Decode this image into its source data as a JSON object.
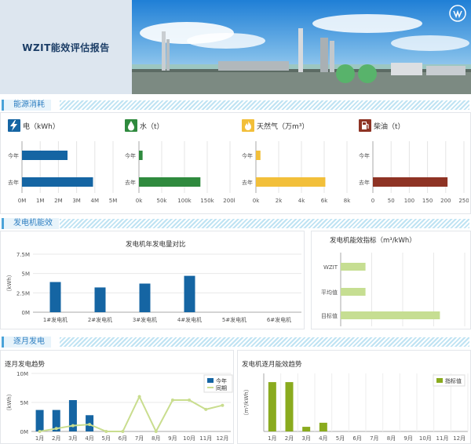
{
  "header": {
    "title": "WZIT能效评估报告"
  },
  "sections": {
    "energy": "能源消耗",
    "generator": "发电机能效",
    "monthly": "逐月发电"
  },
  "colors": {
    "electric": "#1565a3",
    "water": "#2f8a3e",
    "gas": "#f2bf3a",
    "diesel": "#8e3324",
    "efficiency": "#c6de92",
    "monthly_eff": "#8aab1e",
    "prev_line": "#c9dd8e",
    "section_blue": "#2f7fc1"
  },
  "energy_cards": [
    {
      "key": "electric",
      "icon": "lightning-icon",
      "label": "电（kWh）",
      "row_labels": [
        "今年",
        "去年"
      ],
      "chart_data": {
        "type": "bar",
        "orientation": "horizontal",
        "categories": [
          "今年",
          "去年"
        ],
        "values": [
          2500000,
          3900000
        ],
        "xlim": [
          0,
          5000000
        ],
        "ticks": [
          "0M",
          "1M",
          "2M",
          "3M",
          "4M",
          "5M"
        ]
      }
    },
    {
      "key": "water",
      "icon": "water-drop-icon",
      "label": "水（t）",
      "row_labels": [
        "今年",
        "去年"
      ],
      "chart_data": {
        "type": "bar",
        "orientation": "horizontal",
        "categories": [
          "今年",
          "去年"
        ],
        "values": [
          8000,
          135000
        ],
        "xlim": [
          0,
          200000
        ],
        "ticks": [
          "0k",
          "50k",
          "100k",
          "150k",
          "200k"
        ]
      }
    },
    {
      "key": "gas",
      "icon": "flame-icon",
      "label": "天然气（万m³）",
      "row_labels": [
        "今年",
        "去年"
      ],
      "chart_data": {
        "type": "bar",
        "orientation": "horizontal",
        "categories": [
          "今年",
          "去年"
        ],
        "values": [
          400,
          6100
        ],
        "xlim": [
          0,
          8000
        ],
        "ticks": [
          "0k",
          "2k",
          "4k",
          "6k",
          "8k"
        ]
      }
    },
    {
      "key": "diesel",
      "icon": "fuel-pump-icon",
      "label": "柴油（t）",
      "row_labels": [
        "今年",
        "去年"
      ],
      "chart_data": {
        "type": "bar",
        "orientation": "horizontal",
        "categories": [
          "今年",
          "去年"
        ],
        "values": [
          0,
          205
        ],
        "xlim": [
          0,
          250
        ],
        "ticks": [
          "0",
          "50",
          "100",
          "150",
          "200",
          "250"
        ]
      }
    }
  ],
  "generator_output": {
    "title": "发电机年发电量对比",
    "ylabel": "（kWh）",
    "chart_data": {
      "type": "bar",
      "categories": [
        "1#发电机",
        "2#发电机",
        "3#发电机",
        "4#发电机",
        "5#发电机",
        "6#发电机"
      ],
      "values": [
        3900000,
        3200000,
        3700000,
        4700000,
        0,
        0
      ],
      "ylim": [
        0,
        7500000
      ],
      "ticks": [
        "0M",
        "2.5M",
        "5M",
        "7.5M"
      ]
    }
  },
  "generator_eff": {
    "title": "发电机能效指标（m³/kWh）",
    "chart_data": {
      "type": "bar",
      "orientation": "horizontal",
      "categories": [
        "WZIT",
        "平均值",
        "目标值"
      ],
      "values": [
        0.2,
        0.2,
        0.8
      ],
      "xlim": [
        0,
        1
      ]
    }
  },
  "monthly_trend": {
    "title": "逐月发电趋势",
    "ylabel": "（kWh）",
    "legend": [
      "今年",
      "同期"
    ],
    "chart_data": {
      "type": "bar",
      "categories": [
        "1月",
        "2月",
        "3月",
        "4月",
        "5月",
        "6月",
        "7月",
        "8月",
        "9月",
        "10月",
        "11月",
        "12月"
      ],
      "series": [
        {
          "name": "今年",
          "values": [
            3700000,
            3700000,
            5400000,
            2800000,
            0,
            0,
            0,
            0,
            0,
            0,
            0,
            0
          ]
        },
        {
          "name": "同期",
          "values": [
            0,
            500000,
            1000000,
            1200000,
            0,
            0,
            6000000,
            0,
            5400000,
            5400000,
            3800000,
            4500000
          ]
        }
      ],
      "ylim": [
        0,
        10000000
      ],
      "ticks": [
        "0M",
        "5M",
        "10M"
      ]
    }
  },
  "monthly_eff": {
    "title": "发电机逐月能效趋势",
    "ylabel": "（m³/kWh）",
    "legend": [
      "指标值"
    ],
    "chart_data": {
      "type": "bar",
      "categories": [
        "1月",
        "2月",
        "3月",
        "4月",
        "5月",
        "6月",
        "7月",
        "8月",
        "9月",
        "10月",
        "11月",
        "12月"
      ],
      "values": [
        0.85,
        0.85,
        0.08,
        0.15,
        0,
        0,
        0,
        0,
        0,
        0,
        0,
        0
      ],
      "ylim": [
        0,
        1
      ]
    }
  }
}
